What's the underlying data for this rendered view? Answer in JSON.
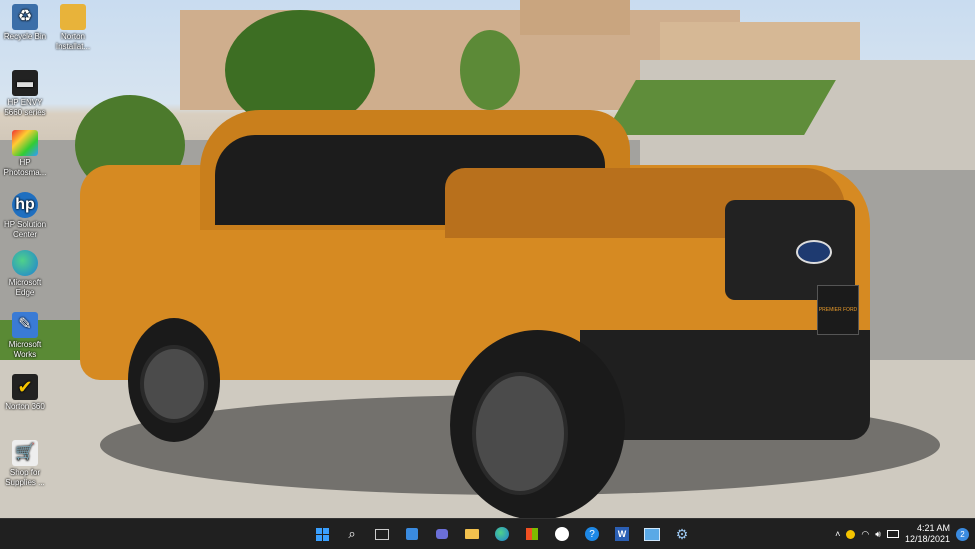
{
  "desktop": {
    "icons": [
      {
        "label": "Recycle Bin",
        "icon": "recycle-bin-icon"
      },
      {
        "label": "Norton Installat...",
        "icon": "folder-icon"
      },
      {
        "label": "HP ENVY 5660 series",
        "icon": "printer-icon"
      },
      {
        "label": "HP Photosma...",
        "icon": "hp-photosmart-icon"
      },
      {
        "label": "HP Solution Center",
        "icon": "hp-icon"
      },
      {
        "label": "Microsoft Edge",
        "icon": "edge-icon"
      },
      {
        "label": "Microsoft Works",
        "icon": "works-icon"
      },
      {
        "label": "Norton 360",
        "icon": "norton-icon"
      },
      {
        "label": "Shop for Supplies ...",
        "icon": "shop-supplies-icon"
      }
    ]
  },
  "wallpaper": {
    "license_plate_text": "PREMIER FORD"
  },
  "taskbar": {
    "apps": [
      {
        "name": "start",
        "icon": "windows-start-icon"
      },
      {
        "name": "search",
        "icon": "search-icon"
      },
      {
        "name": "task-view",
        "icon": "task-view-icon"
      },
      {
        "name": "widgets",
        "icon": "widgets-icon"
      },
      {
        "name": "chat",
        "icon": "chat-icon"
      },
      {
        "name": "file-explorer",
        "icon": "folder-icon"
      },
      {
        "name": "edge",
        "icon": "edge-icon"
      },
      {
        "name": "store",
        "icon": "store-icon"
      },
      {
        "name": "github",
        "icon": "github-icon"
      },
      {
        "name": "help",
        "icon": "help-icon"
      },
      {
        "name": "word",
        "icon": "word-icon"
      },
      {
        "name": "photos",
        "icon": "photos-icon"
      },
      {
        "name": "settings",
        "icon": "gear-icon"
      }
    ],
    "tray": {
      "time": "4:21 AM",
      "date": "12/18/2021",
      "notifications": "2"
    }
  },
  "colors": {
    "taskbar": "#202020",
    "truck": "#d68a22",
    "accent": "#3a8be0"
  }
}
